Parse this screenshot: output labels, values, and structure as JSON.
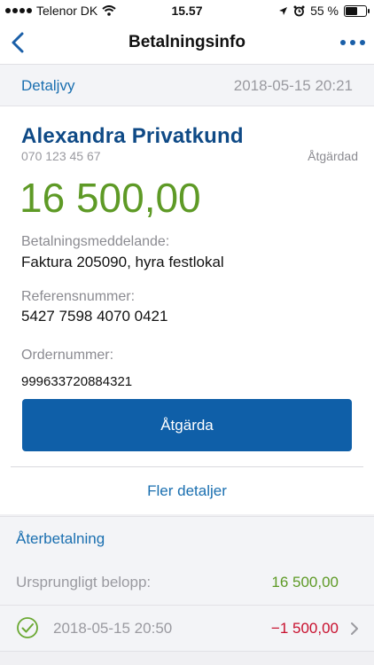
{
  "status_bar": {
    "carrier": "Telenor DK",
    "time": "15.57",
    "battery": "55 %",
    "icons": [
      "signal-dots-icon",
      "wifi-icon",
      "location-arrow-icon",
      "alarm-icon",
      "battery-icon"
    ]
  },
  "nav": {
    "title": "Betalningsinfo",
    "back_icon": "chevron-left-icon",
    "more_icon": "more-dots-icon",
    "accent": "#1a5fa8"
  },
  "detail": {
    "label": "Detaljvy",
    "timestamp": "2018-05-15 20:21"
  },
  "payment": {
    "name": "Alexandra Privatkund",
    "phone": "070 123 45 67",
    "status": "Åtgärdad",
    "amount": "16 500,00",
    "amount_color": "#5e9a26",
    "message_label": "Betalningsmeddelande:",
    "message_value": "Faktura 205090, hyra festlokal",
    "reference_label": "Referensnummer:",
    "reference_value": "5427 7598 4070 0421",
    "order_label": "Ordernummer:",
    "order_value": "999633720884321",
    "action_label": "Åtgärda",
    "more_link": "Fler detaljer"
  },
  "refund": {
    "header": "Återbetalning",
    "original_label": "Ursprungligt belopp:",
    "original_value": "16 500,00",
    "original_color": "#5e9a26",
    "refund_date": "2018-05-15 20:50",
    "refund_value": "−1 500,00",
    "refund_color": "#c8102e",
    "check_icon": "check-circle-icon",
    "chevron_icon": "chevron-right-icon"
  }
}
